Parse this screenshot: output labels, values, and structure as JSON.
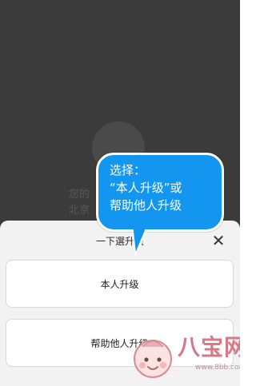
{
  "background": {
    "line1": "您的",
    "line2": "北京"
  },
  "sheet": {
    "title": "一下選升级",
    "close_icon": "close-icon",
    "options": [
      {
        "label": "本人升级"
      },
      {
        "label": "帮助他人升级"
      }
    ]
  },
  "callout": {
    "line1": "选择：",
    "line2": "“本人升级”或",
    "line3": "帮助他人升级",
    "color": "#1296f0"
  },
  "watermark": {
    "brand": "八宝网",
    "url": "www.8bb.com",
    "brand_color": "#d47986"
  }
}
